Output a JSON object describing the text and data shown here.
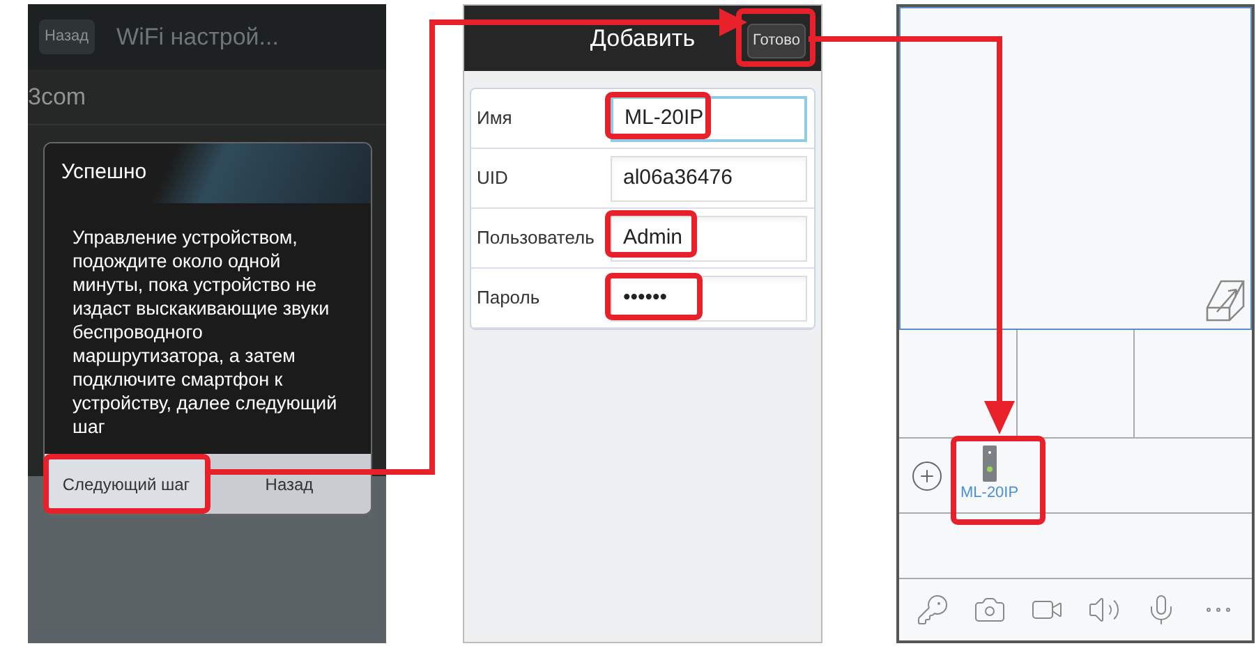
{
  "wifi_screen": {
    "back_button": "Назад",
    "title": "WiFi настрой...",
    "networks": [
      "3com"
    ],
    "dialog": {
      "title": "Успешно",
      "message": "Управление устройством, подождите около одной минуты, пока устройство не издаст выскакивающие звуки беспроводного маршрутизатора, а затем подключите смартфон к устройству, далее следующий шаг",
      "buttons": [
        "Следующий шаг",
        "Назад"
      ]
    }
  },
  "add_screen": {
    "title": "Добавить",
    "done_button": "Готово",
    "fields": [
      {
        "label": "Имя",
        "value": "ML-20IP",
        "focused": true
      },
      {
        "label": "UID",
        "value": "al06a36476",
        "focused": false
      },
      {
        "label": "Пользователь",
        "value": "Admin",
        "focused": false
      },
      {
        "label": "Пароль",
        "value": "••••••",
        "focused": false
      }
    ]
  },
  "live_screen": {
    "devices": [
      {
        "name": "ML-20IP"
      }
    ]
  }
}
